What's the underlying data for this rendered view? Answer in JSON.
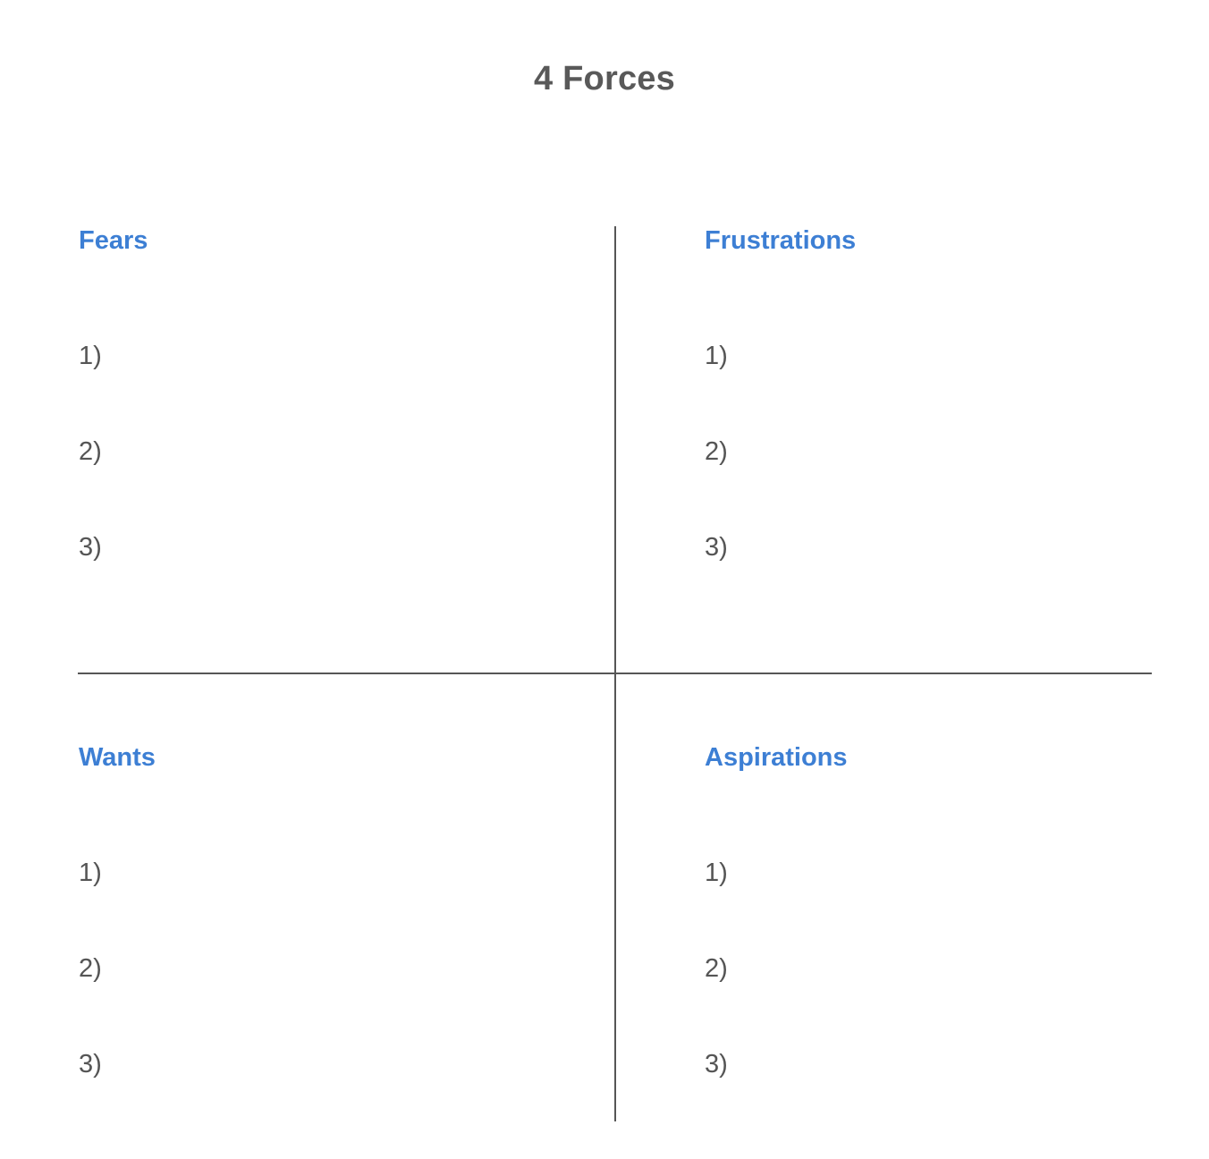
{
  "document": {
    "title": "4 Forces",
    "background_color": "#ffffff"
  },
  "theme": {
    "title_color": "#595959",
    "heading_color": "#3d7fd4",
    "body_text_color": "#555555",
    "divider_color": "#565656"
  },
  "quadrants": [
    {
      "id": "fears",
      "title": "Fears",
      "position": "top-left",
      "items": [
        "1)",
        "2)",
        "3)"
      ]
    },
    {
      "id": "frustrations",
      "title": "Frustrations",
      "position": "top-right",
      "items": [
        "1)",
        "2)",
        "3)"
      ]
    },
    {
      "id": "wants",
      "title": "Wants",
      "position": "bottom-left",
      "items": [
        "1)",
        "2)",
        "3)"
      ]
    },
    {
      "id": "aspirations",
      "title": "Aspirations",
      "position": "bottom-right",
      "items": [
        "1)",
        "2)",
        "3)"
      ]
    }
  ]
}
